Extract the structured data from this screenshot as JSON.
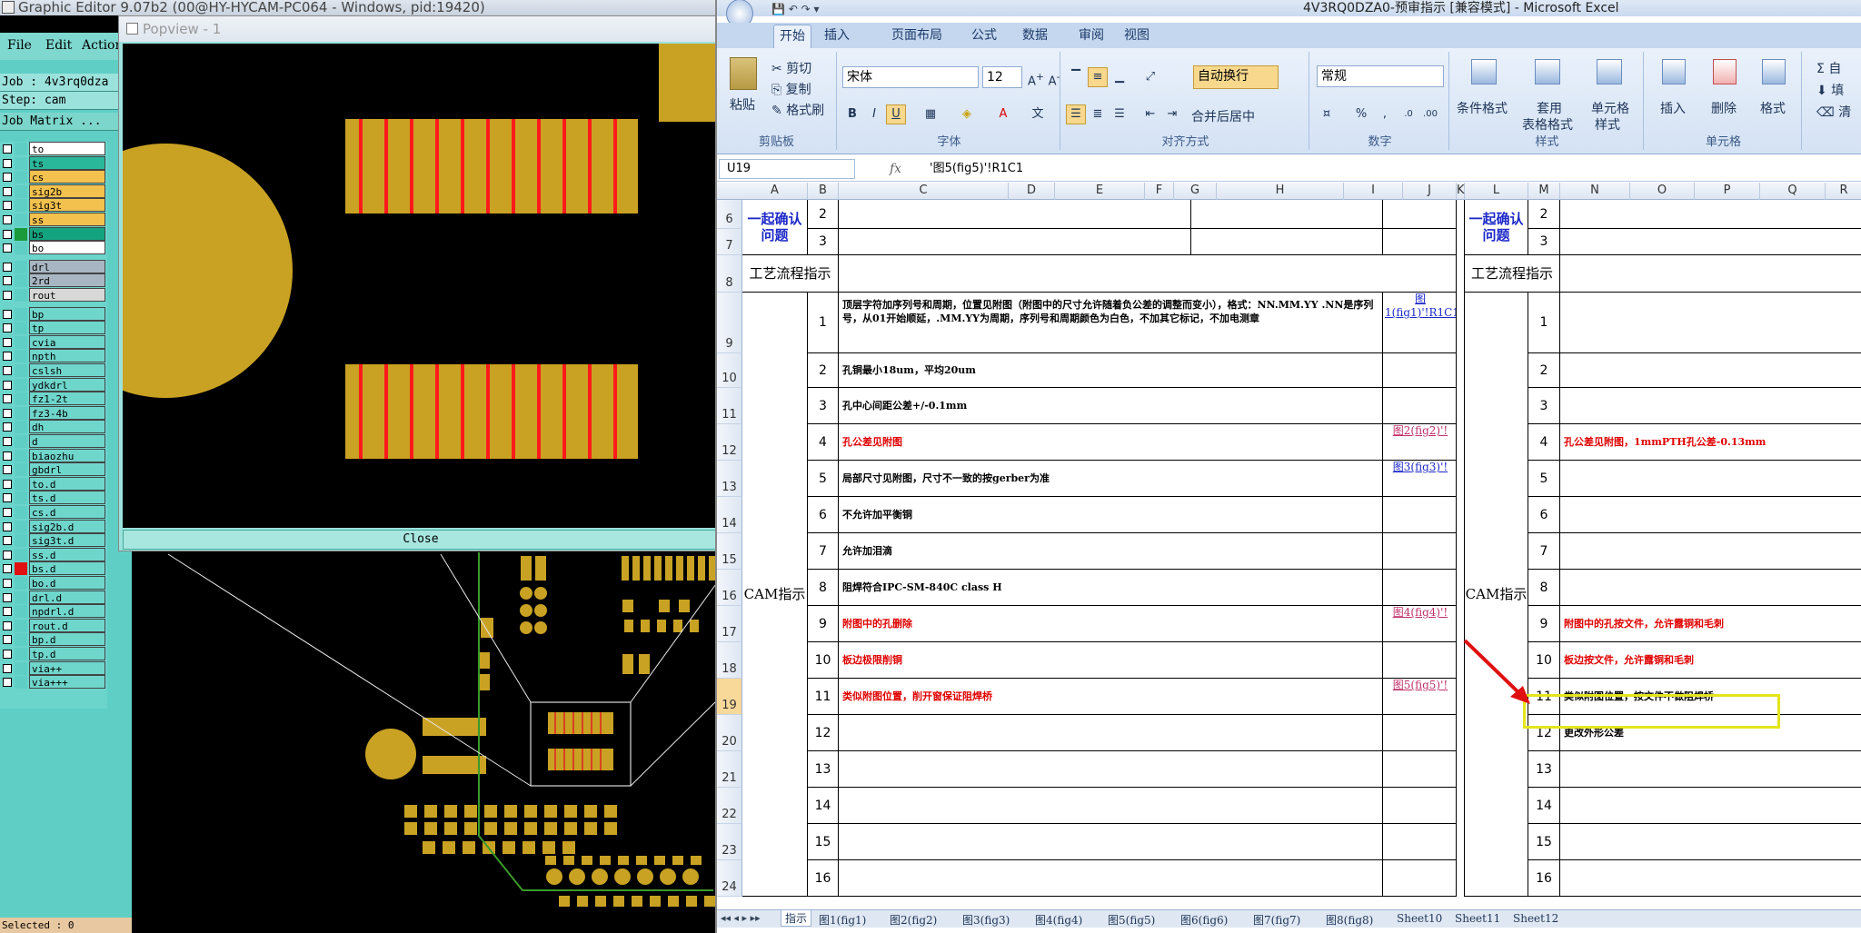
{
  "graphic_editor": {
    "title": "Graphic Editor 9.07b2 (00@HY-HYCAM-PC064 - Windows, pid:19420)",
    "menu": [
      "File",
      "Edit",
      "Action"
    ],
    "job": "Job : 4v3rq0dza",
    "step": "Step: cam",
    "job_matrix": "Job Matrix ...",
    "status": "Selected : 0",
    "layers": [
      {
        "name": "to",
        "color": "#ffffff"
      },
      {
        "name": "ts",
        "color": "#2ab89b"
      },
      {
        "name": "cs",
        "color": "#f2c14e"
      },
      {
        "name": "sig2b",
        "color": "#f2c14e"
      },
      {
        "name": "sig3t",
        "color": "#f2c14e"
      },
      {
        "name": "ss",
        "color": "#f2c14e"
      },
      {
        "name": "bs",
        "color": "#14a37f"
      },
      {
        "name": "bo",
        "color": "#ffffff"
      },
      {
        "name": "drl",
        "color": "#a7b6c2"
      },
      {
        "name": "2rd",
        "color": "#a7b6c2"
      },
      {
        "name": "rout",
        "color": "#d8d8d8"
      },
      {
        "name": "bp",
        "color": "#6fd6cc"
      },
      {
        "name": "tp",
        "color": "#6fd6cc"
      },
      {
        "name": "cvia",
        "color": "#6fd6cc"
      },
      {
        "name": "npth",
        "color": "#6fd6cc"
      },
      {
        "name": "cslsh",
        "color": "#6fd6cc"
      },
      {
        "name": "ydkdrl",
        "color": "#6fd6cc"
      },
      {
        "name": "fz1-2t",
        "color": "#6fd6cc"
      },
      {
        "name": "fz3-4b",
        "color": "#6fd6cc"
      },
      {
        "name": "dh",
        "color": "#6fd6cc"
      },
      {
        "name": "d",
        "color": "#6fd6cc"
      },
      {
        "name": "biaozhu",
        "color": "#6fd6cc"
      },
      {
        "name": "gbdrl",
        "color": "#6fd6cc"
      },
      {
        "name": "to.d",
        "color": "#6fd6cc"
      },
      {
        "name": "ts.d",
        "color": "#6fd6cc"
      },
      {
        "name": "cs.d",
        "color": "#6fd6cc"
      },
      {
        "name": "sig2b.d",
        "color": "#6fd6cc"
      },
      {
        "name": "sig3t.d",
        "color": "#6fd6cc"
      },
      {
        "name": "ss.d",
        "color": "#6fd6cc"
      },
      {
        "name": "bs.d",
        "color": "#6fd6cc"
      },
      {
        "name": "bo.d",
        "color": "#6fd6cc"
      },
      {
        "name": "drl.d",
        "color": "#6fd6cc"
      },
      {
        "name": "npdrl.d",
        "color": "#6fd6cc"
      },
      {
        "name": "rout.d",
        "color": "#6fd6cc"
      },
      {
        "name": "bp.d",
        "color": "#6fd6cc"
      },
      {
        "name": "tp.d",
        "color": "#6fd6cc"
      },
      {
        "name": "via++",
        "color": "#6fd6cc"
      },
      {
        "name": "via+++",
        "color": "#6fd6cc"
      }
    ]
  },
  "popview": {
    "title": "Popview - 1",
    "close": "Close"
  },
  "excel": {
    "title": "4V3RQ0DZA0-预审指示  [兼容模式] - Microsoft Excel",
    "tabs": [
      "开始",
      "插入",
      "页面布局",
      "公式",
      "数据",
      "审阅",
      "视图"
    ],
    "ribbon": {
      "paste": "粘贴",
      "cut": "剪切",
      "copy": "复制",
      "format_painter": "格式刷",
      "clipboard": "剪贴板",
      "font_name": "宋体",
      "font_size": "12",
      "font_group": "字体",
      "wrap": "自动换行",
      "merge": "合并后居中",
      "align_group": "对齐方式",
      "number_format": "常规",
      "number_group": "数字",
      "cond_format": "条件格式",
      "table_format_1": "套用",
      "table_format_2": "表格格式",
      "cell_style_1": "单元格",
      "cell_style_2": "样式",
      "style_group": "样式",
      "insert": "插入",
      "delete": "删除",
      "format": "格式",
      "cells_group": "单元格",
      "autosum": "自",
      "fill": "填",
      "clear": "清"
    },
    "name_box": "U19",
    "formula": "'图5(fig5)'!R1C1",
    "columns": [
      "A",
      "B",
      "C",
      "D",
      "E",
      "F",
      "G",
      "H",
      "I",
      "J",
      "K",
      "L",
      "M",
      "N",
      "O",
      "P",
      "Q",
      "R"
    ],
    "row_numbers": [
      "6",
      "7",
      "8",
      "9",
      "10",
      "11",
      "12",
      "13",
      "14",
      "15",
      "16",
      "17",
      "18",
      "19",
      "20",
      "21",
      "22",
      "23",
      "24"
    ],
    "left": {
      "header_confirm": "一起确认问题",
      "header_flow": "工艺流程指示",
      "header_cam": "CAM指示",
      "confirm_nums": [
        "2",
        "3"
      ],
      "items": [
        {
          "n": "1",
          "text": "顶层字符加序列号和周期，位置见附图（附图中的尺寸允许随着负公差的调整而变小），格式：NN.MM.YY .NN是序列号，从01开始顺延，.MM.YY为周期，序列号和周期颜色为白色，不加其它标记，不加电测章",
          "link": "图1(fig1)'!R1C1",
          "red": false
        },
        {
          "n": "2",
          "text": "孔铜最小18um，平均20um",
          "link": "",
          "red": false
        },
        {
          "n": "3",
          "text": "孔中心间距公差+/-0.1mm",
          "link": "",
          "red": false
        },
        {
          "n": "4",
          "text": "孔公差见附图",
          "link": "图2(fig2)'!",
          "red": true
        },
        {
          "n": "5",
          "text": "局部尺寸见附图，尺寸不一致的按gerber为准",
          "link": "图3(fig3)'!",
          "red": false
        },
        {
          "n": "6",
          "text": "不允许加平衡铜",
          "link": "",
          "red": false
        },
        {
          "n": "7",
          "text": "允许加泪滴",
          "link": "",
          "red": false
        },
        {
          "n": "8",
          "text": "阻焊符合IPC-SM-840C class H",
          "link": "",
          "red": false
        },
        {
          "n": "9",
          "text": "附图中的孔删除",
          "link": "图4(fig4)'!",
          "red": true
        },
        {
          "n": "10",
          "text": "板边极限削铜",
          "link": "",
          "red": true
        },
        {
          "n": "11",
          "text": "类似附图位置，削开窗保证阻焊桥",
          "link": "图5(fig5)'!",
          "red": true
        },
        {
          "n": "12",
          "text": "",
          "link": "",
          "red": false
        },
        {
          "n": "13",
          "text": "",
          "link": "",
          "red": false
        },
        {
          "n": "14",
          "text": "",
          "link": "",
          "red": false
        },
        {
          "n": "15",
          "text": "",
          "link": "",
          "red": false
        },
        {
          "n": "16",
          "text": "",
          "link": "",
          "red": false
        }
      ]
    },
    "right": {
      "header_confirm": "一起确认问题",
      "header_flow": "工艺流程指示",
      "header_cam": "CAM指示",
      "confirm_nums": [
        "2",
        "3"
      ],
      "items": [
        {
          "n": "1",
          "text": "",
          "red": false
        },
        {
          "n": "2",
          "text": "",
          "red": false
        },
        {
          "n": "3",
          "text": "",
          "red": false
        },
        {
          "n": "4",
          "text": "孔公差见附图，1mmPTH孔公差-0.13mm",
          "red": true
        },
        {
          "n": "5",
          "text": "",
          "red": false
        },
        {
          "n": "6",
          "text": "",
          "red": false
        },
        {
          "n": "7",
          "text": "",
          "red": false
        },
        {
          "n": "8",
          "text": "",
          "red": false
        },
        {
          "n": "9",
          "text": "附图中的孔按文件，允许露铜和毛刺",
          "red": true
        },
        {
          "n": "10",
          "text": "板边按文件，允许露铜和毛刺",
          "red": true
        },
        {
          "n": "11",
          "text": "类似附图位置，按文件不做阻焊桥",
          "red": false
        },
        {
          "n": "12",
          "text": "更改外形公差",
          "red": false
        },
        {
          "n": "13",
          "text": "",
          "red": false
        },
        {
          "n": "14",
          "text": "",
          "red": false
        },
        {
          "n": "15",
          "text": "",
          "red": false
        },
        {
          "n": "16",
          "text": "",
          "red": false
        }
      ]
    },
    "sheet_tabs": [
      "指示",
      "图1(fig1)",
      "图2(fig2)",
      "图3(fig3)",
      "图4(fig4)",
      "图5(fig5)",
      "图6(fig6)",
      "图7(fig7)",
      "图8(fig8)",
      "Sheet10",
      "Sheet11",
      "Sheet12"
    ],
    "colors": {
      "accent_yellow": "#e5e51b",
      "arrow_red": "#e01010",
      "link_blue": "#1c28c8",
      "text_red": "#e00000"
    }
  }
}
